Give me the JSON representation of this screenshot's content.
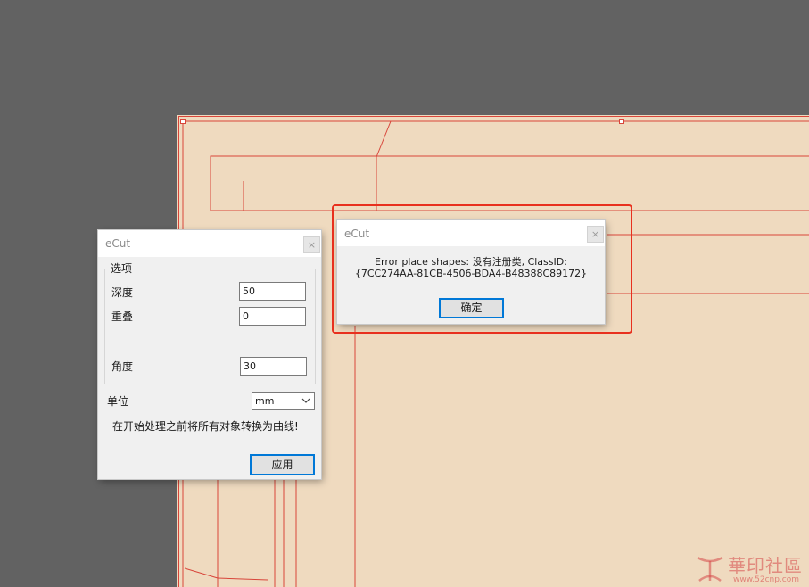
{
  "ecut_panel": {
    "title": "eCut",
    "close_glyph": "×",
    "group_caption": "选项",
    "depth_label": "深度",
    "depth_value": "50",
    "overlap_label": "重叠",
    "overlap_value": "0",
    "angle_label": "角度",
    "angle_value": "30",
    "unit_label": "单位",
    "unit_selected": "mm",
    "note": "在开始处理之前将所有对象转换为曲线!",
    "apply_label": "应用"
  },
  "error_dialog": {
    "title": "eCut",
    "close_glyph": "×",
    "message_line1": "Error place shapes: 没有注册类, ClassID:",
    "message_line2": "{7CC274AA-81CB-4506-BDA4-B48388C89172}",
    "ok_label": "确定"
  },
  "watermark": {
    "text": "華印社區",
    "url": "www.52cnp.com"
  },
  "colors": {
    "desktop": "#626262",
    "canvas": "#efdabf",
    "cut_line": "#d8453a",
    "highlight": "#e8301e",
    "accent": "#0078d7"
  }
}
